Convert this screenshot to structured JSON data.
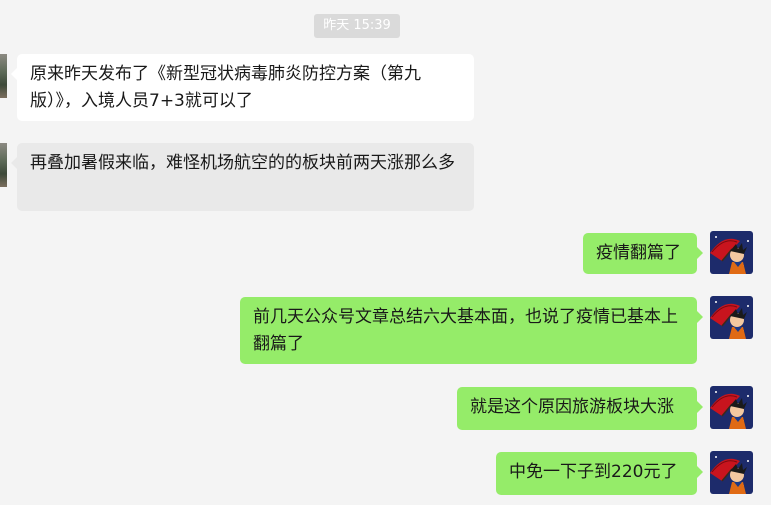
{
  "chat": {
    "timestamp": "昨天 15:39",
    "messages": [
      {
        "sender": "other",
        "text": "原来昨天发布了《新型冠状病毒肺炎防控方案（第九版）》，入境人员7+3就可以了"
      },
      {
        "sender": "other",
        "text": "再叠加暑假来临，难怪机场航空的的板块前两天涨那么多"
      },
      {
        "sender": "self",
        "text": "疫情翻篇了"
      },
      {
        "sender": "self",
        "text": "前几天公众号文章总结六大基本面，也说了疫情已基本上翻篇了"
      },
      {
        "sender": "self",
        "text": "就是这个原因旅游板块大涨"
      },
      {
        "sender": "self",
        "text": "中免一下子到220元了"
      }
    ]
  },
  "colors": {
    "background": "#f4f4f4",
    "incoming_bubble": "#ffffff",
    "incoming_bubble_highlighted": "#e9e9e9",
    "outgoing_bubble": "#95ec69",
    "timestamp_bg": "#dadada"
  },
  "icons": {
    "self_avatar": "anime-character-red-umbrella-avatar",
    "other_avatar": "landscape-photo-avatar"
  }
}
